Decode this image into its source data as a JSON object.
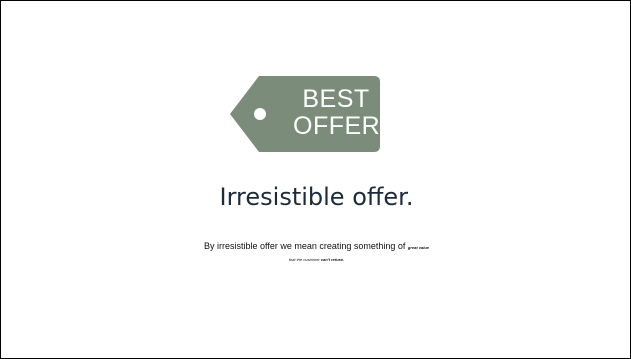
{
  "slide": {
    "tag": {
      "line1": "BEST",
      "line2": "OFFER",
      "color": "#7b8c7b",
      "icon": "price-tag-icon"
    },
    "title": "Irresistible offer.",
    "description": {
      "prefix": "By irresistible offer we mean creating something of ",
      "emphasis": "great value"
    },
    "subline": {
      "prefix": "that the customer ",
      "emphasis": "can't refuse."
    }
  }
}
